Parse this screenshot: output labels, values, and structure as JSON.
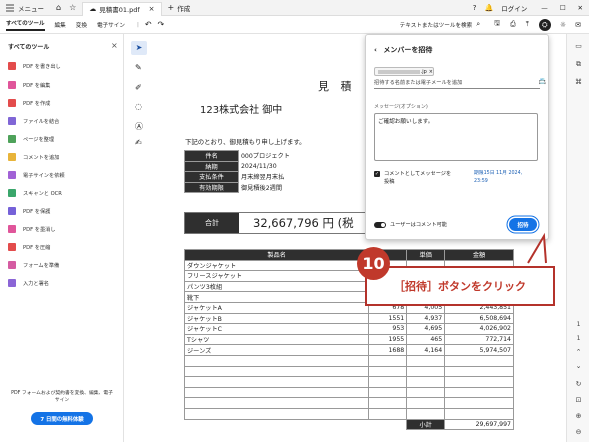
{
  "titlebar": {
    "menu_label": "メニュー",
    "tab_title": "見積書01.pdf",
    "new_tab_label": "作成",
    "login_label": "ログイン"
  },
  "menubar": {
    "items": [
      "すべてのツール",
      "編集",
      "変換",
      "電子サイン"
    ],
    "search_label": "テキストまたはツールを検索"
  },
  "sidebar": {
    "title": "すべてのツール",
    "tools": [
      {
        "label": "PDF を書き出し",
        "color": "#e34c4c"
      },
      {
        "label": "PDF を編集",
        "color": "#e0559a"
      },
      {
        "label": "PDF を作成",
        "color": "#e34c4c"
      },
      {
        "label": "ファイルを結合",
        "color": "#8066d6"
      },
      {
        "label": "ページを整理",
        "color": "#4ea25a"
      },
      {
        "label": "コメントを追加",
        "color": "#e8b43a"
      },
      {
        "label": "電子サインを依頼",
        "color": "#a162d6"
      },
      {
        "label": "スキャンと OCR",
        "color": "#3aa66b"
      },
      {
        "label": "PDF を保護",
        "color": "#7561d8"
      },
      {
        "label": "PDF を墨消し",
        "color": "#e0559a"
      },
      {
        "label": "PDF を圧縮",
        "color": "#e34c4c"
      },
      {
        "label": "フォームを準備",
        "color": "#d55ca2"
      },
      {
        "label": "入力と署名",
        "color": "#8b65d6"
      }
    ],
    "promo_text_1": "PDF フォームおよび契約書を変換、編集、電子",
    "promo_text_2": "サイン",
    "trial_button": "7 日間の無料体験"
  },
  "document": {
    "title": "見 積",
    "recipient": "123株式会社 御中",
    "intro": "下記のとおり、御見積もり申し上げます。",
    "info": [
      {
        "key": "件名",
        "value": "000プロジェクト"
      },
      {
        "key": "納期",
        "value": "2024/11/30"
      },
      {
        "key": "支払条件",
        "value": "月末締翌月末払"
      },
      {
        "key": "有効期限",
        "value": "御見積後2週間"
      }
    ],
    "total_label": "合計",
    "total_value": "32,667,796 円 (税",
    "columns": [
      "製品名",
      "",
      "単価",
      "金額"
    ],
    "rows": [
      {
        "name": "ダウンジャケット",
        "qty": "",
        "price": "",
        "amount": ""
      },
      {
        "name": "フリースジャケット",
        "qty": "",
        "price": "",
        "amount": ""
      },
      {
        "name": "パンツ3枚組",
        "qty": "",
        "price": "",
        "amount": ""
      },
      {
        "name": "靴下",
        "qty": "",
        "price": "",
        "amount": ""
      },
      {
        "name": "ジャケットA",
        "qty": "678",
        "price": "4,005",
        "amount": "2,443,851"
      },
      {
        "name": "ジャケットB",
        "qty": "1551",
        "price": "4,937",
        "amount": "6,508,694"
      },
      {
        "name": "ジャケットC",
        "qty": "953",
        "price": "4,695",
        "amount": "4,026,902"
      },
      {
        "name": "Tシャツ",
        "qty": "1955",
        "price": "465",
        "amount": "772,714"
      },
      {
        "name": "ジーンズ",
        "qty": "1688",
        "price": "4,164",
        "amount": "5,974,507"
      }
    ],
    "subtotal_label": "小計",
    "subtotal_value": "29,697,997"
  },
  "invite_panel": {
    "title": "メンバーを招待",
    "email_chip_suffix": ".jp",
    "hint": "招待する名前または電子メールを追加",
    "message_label": "メッセージ(オプション)",
    "message_value": "ご確認お願いします。",
    "checkbox_label_1": "コメントとしてメッセージを",
    "checkbox_label_2": "投稿",
    "deadline_1": "期限15日 11月 2024,",
    "deadline_2": "23:59",
    "toggle_label": "ユーザーはコメント可能",
    "invite_button": "招待"
  },
  "callout": {
    "step": "10",
    "text": "［招待］ボタンをクリック"
  }
}
